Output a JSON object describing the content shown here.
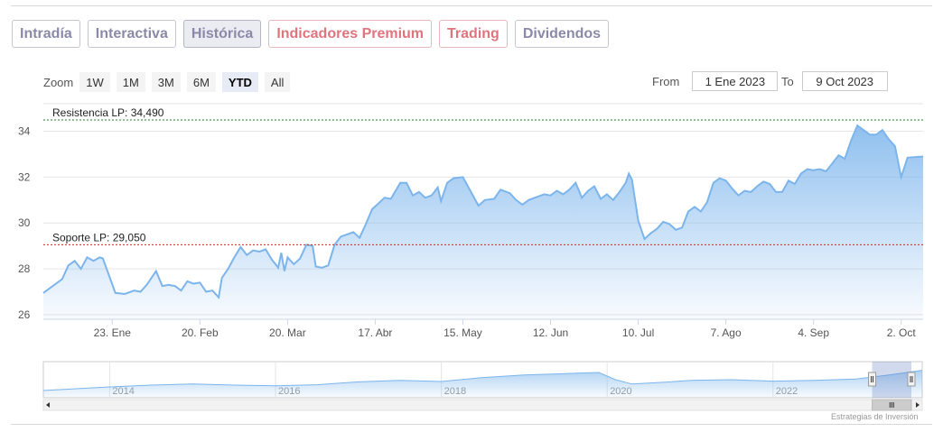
{
  "tabs": [
    {
      "label": "Intradía",
      "style": "normal"
    },
    {
      "label": "Interactiva",
      "style": "normal"
    },
    {
      "label": "Histórica",
      "style": "active"
    },
    {
      "label": "Indicadores Premium",
      "style": "red"
    },
    {
      "label": "Trading",
      "style": "red"
    },
    {
      "label": "Dividendos",
      "style": "normal"
    }
  ],
  "zoom": {
    "label": "Zoom",
    "buttons": [
      "1W",
      "1M",
      "3M",
      "6M",
      "YTD",
      "All"
    ],
    "selected": "YTD"
  },
  "range": {
    "from_label": "From",
    "from_value": "1 Ene 2023",
    "to_label": "To",
    "to_value": "9 Oct 2023"
  },
  "credits": "Estrategias de Inversión",
  "colors": {
    "line": "#7cb5ec",
    "area_top": "#7cb5ec",
    "resistance": "#2e7d32",
    "support": "#c62828"
  },
  "chart_data": {
    "type": "area",
    "title": "",
    "xlabel": "",
    "ylabel": "",
    "x_range": [
      "2023-01-01",
      "2023-10-09"
    ],
    "ylim": [
      25.8,
      35.2
    ],
    "y_ticks": [
      26,
      28,
      30,
      32,
      34
    ],
    "x_ticks": [
      {
        "date": "2023-01-23",
        "label": "23. Ene"
      },
      {
        "date": "2023-02-20",
        "label": "20. Feb"
      },
      {
        "date": "2023-03-20",
        "label": "20. Mar"
      },
      {
        "date": "2023-04-17",
        "label": "17. Abr"
      },
      {
        "date": "2023-05-15",
        "label": "15. May"
      },
      {
        "date": "2023-06-12",
        "label": "12. Jun"
      },
      {
        "date": "2023-07-10",
        "label": "10. Jul"
      },
      {
        "date": "2023-08-07",
        "label": "7. Ago"
      },
      {
        "date": "2023-09-04",
        "label": "4. Sep"
      },
      {
        "date": "2023-10-02",
        "label": "2. Oct"
      }
    ],
    "plot_lines": [
      {
        "label": "Resistencia LP: 34,490",
        "value": 34.49,
        "kind": "resistance"
      },
      {
        "label": "Soporte LP: 29,050",
        "value": 29.05,
        "kind": "support"
      }
    ],
    "series": [
      {
        "points": [
          [
            "2023-01-01",
            26.95
          ],
          [
            "2023-01-03",
            27.15
          ],
          [
            "2023-01-05",
            27.35
          ],
          [
            "2023-01-07",
            27.55
          ],
          [
            "2023-01-09",
            28.15
          ],
          [
            "2023-01-11",
            28.35
          ],
          [
            "2023-01-13",
            28.0
          ],
          [
            "2023-01-15",
            28.5
          ],
          [
            "2023-01-17",
            28.35
          ],
          [
            "2023-01-19",
            28.5
          ],
          [
            "2023-01-20",
            28.45
          ],
          [
            "2023-01-22",
            27.7
          ],
          [
            "2023-01-24",
            26.95
          ],
          [
            "2023-01-27",
            26.9
          ],
          [
            "2023-01-30",
            27.05
          ],
          [
            "2023-02-01",
            27.0
          ],
          [
            "2023-02-03",
            27.3
          ],
          [
            "2023-02-06",
            27.9
          ],
          [
            "2023-02-08",
            27.25
          ],
          [
            "2023-02-10",
            27.3
          ],
          [
            "2023-02-12",
            27.25
          ],
          [
            "2023-02-14",
            27.05
          ],
          [
            "2023-02-16",
            27.45
          ],
          [
            "2023-02-18",
            27.35
          ],
          [
            "2023-02-20",
            27.4
          ],
          [
            "2023-02-22",
            27.0
          ],
          [
            "2023-02-24",
            27.05
          ],
          [
            "2023-02-26",
            26.75
          ],
          [
            "2023-02-27",
            27.6
          ],
          [
            "2023-03-01",
            28.0
          ],
          [
            "2023-03-03",
            28.5
          ],
          [
            "2023-03-05",
            28.95
          ],
          [
            "2023-03-07",
            28.6
          ],
          [
            "2023-03-09",
            28.8
          ],
          [
            "2023-03-11",
            28.75
          ],
          [
            "2023-03-13",
            28.85
          ],
          [
            "2023-03-15",
            28.4
          ],
          [
            "2023-03-17",
            28.05
          ],
          [
            "2023-03-18",
            28.7
          ],
          [
            "2023-03-19",
            27.9
          ],
          [
            "2023-03-20",
            28.5
          ],
          [
            "2023-03-22",
            28.2
          ],
          [
            "2023-03-24",
            28.45
          ],
          [
            "2023-03-26",
            29.05
          ],
          [
            "2023-03-28",
            29.0
          ],
          [
            "2023-03-29",
            28.1
          ],
          [
            "2023-03-31",
            28.05
          ],
          [
            "2023-04-02",
            28.15
          ],
          [
            "2023-04-04",
            29.05
          ],
          [
            "2023-04-06",
            29.4
          ],
          [
            "2023-04-08",
            29.5
          ],
          [
            "2023-04-10",
            29.6
          ],
          [
            "2023-04-12",
            29.35
          ],
          [
            "2023-04-14",
            29.95
          ],
          [
            "2023-04-16",
            30.6
          ],
          [
            "2023-04-18",
            30.85
          ],
          [
            "2023-04-20",
            31.1
          ],
          [
            "2023-04-22",
            31.05
          ],
          [
            "2023-04-25",
            31.75
          ],
          [
            "2023-04-27",
            31.75
          ],
          [
            "2023-04-29",
            31.2
          ],
          [
            "2023-05-01",
            31.35
          ],
          [
            "2023-05-03",
            31.1
          ],
          [
            "2023-05-05",
            31.2
          ],
          [
            "2023-05-07",
            31.55
          ],
          [
            "2023-05-08",
            30.95
          ],
          [
            "2023-05-10",
            31.75
          ],
          [
            "2023-05-12",
            31.95
          ],
          [
            "2023-05-15",
            32.0
          ],
          [
            "2023-05-17",
            31.5
          ],
          [
            "2023-05-20",
            30.75
          ],
          [
            "2023-05-22",
            31.0
          ],
          [
            "2023-05-25",
            31.05
          ],
          [
            "2023-05-27",
            31.45
          ],
          [
            "2023-05-30",
            31.3
          ],
          [
            "2023-06-01",
            31.0
          ],
          [
            "2023-06-03",
            30.8
          ],
          [
            "2023-06-05",
            31.0
          ],
          [
            "2023-06-07",
            31.1
          ],
          [
            "2023-06-10",
            31.25
          ],
          [
            "2023-06-12",
            31.2
          ],
          [
            "2023-06-14",
            31.4
          ],
          [
            "2023-06-16",
            31.25
          ],
          [
            "2023-06-18",
            31.45
          ],
          [
            "2023-06-20",
            31.75
          ],
          [
            "2023-06-22",
            31.1
          ],
          [
            "2023-06-24",
            31.4
          ],
          [
            "2023-06-26",
            31.6
          ],
          [
            "2023-06-28",
            31.05
          ],
          [
            "2023-06-30",
            31.25
          ],
          [
            "2023-07-02",
            31.0
          ],
          [
            "2023-07-04",
            31.35
          ],
          [
            "2023-07-06",
            31.75
          ],
          [
            "2023-07-07",
            32.15
          ],
          [
            "2023-07-08",
            31.9
          ],
          [
            "2023-07-10",
            30.1
          ],
          [
            "2023-07-12",
            29.3
          ],
          [
            "2023-07-14",
            29.55
          ],
          [
            "2023-07-16",
            29.75
          ],
          [
            "2023-07-18",
            30.05
          ],
          [
            "2023-07-20",
            29.95
          ],
          [
            "2023-07-22",
            29.7
          ],
          [
            "2023-07-24",
            29.8
          ],
          [
            "2023-07-26",
            30.5
          ],
          [
            "2023-07-28",
            30.7
          ],
          [
            "2023-07-30",
            30.5
          ],
          [
            "2023-08-01",
            30.9
          ],
          [
            "2023-08-03",
            31.75
          ],
          [
            "2023-08-05",
            31.95
          ],
          [
            "2023-08-07",
            31.85
          ],
          [
            "2023-08-09",
            31.5
          ],
          [
            "2023-08-11",
            31.2
          ],
          [
            "2023-08-13",
            31.4
          ],
          [
            "2023-08-15",
            31.35
          ],
          [
            "2023-08-17",
            31.6
          ],
          [
            "2023-08-19",
            31.8
          ],
          [
            "2023-08-21",
            31.7
          ],
          [
            "2023-08-23",
            31.35
          ],
          [
            "2023-08-25",
            31.35
          ],
          [
            "2023-08-27",
            31.85
          ],
          [
            "2023-08-29",
            31.7
          ],
          [
            "2023-08-31",
            32.15
          ],
          [
            "2023-09-02",
            32.35
          ],
          [
            "2023-09-04",
            32.3
          ],
          [
            "2023-09-06",
            32.35
          ],
          [
            "2023-09-08",
            32.25
          ],
          [
            "2023-09-10",
            32.6
          ],
          [
            "2023-09-12",
            32.95
          ],
          [
            "2023-09-14",
            32.8
          ],
          [
            "2023-09-16",
            33.6
          ],
          [
            "2023-09-18",
            34.25
          ],
          [
            "2023-09-20",
            34.05
          ],
          [
            "2023-09-22",
            33.85
          ],
          [
            "2023-09-24",
            33.85
          ],
          [
            "2023-09-26",
            34.05
          ],
          [
            "2023-09-28",
            33.65
          ],
          [
            "2023-09-30",
            33.35
          ],
          [
            "2023-10-02",
            32.0
          ],
          [
            "2023-10-04",
            32.85
          ],
          [
            "2023-10-09",
            32.9
          ]
        ]
      }
    ],
    "navigator": {
      "x_ticks": [
        "2014",
        "2016",
        "2018",
        "2020",
        "2022"
      ],
      "years": [
        2013.2,
        2023.8
      ],
      "points": [
        [
          2013.2,
          26.0
        ],
        [
          2013.6,
          26.5
        ],
        [
          2014.0,
          27.0
        ],
        [
          2014.5,
          27.5
        ],
        [
          2015.0,
          27.8
        ],
        [
          2015.5,
          27.5
        ],
        [
          2016.0,
          27.3
        ],
        [
          2016.5,
          27.6
        ],
        [
          2017.0,
          28.4
        ],
        [
          2017.5,
          28.8
        ],
        [
          2018.0,
          28.5
        ],
        [
          2018.5,
          29.6
        ],
        [
          2019.0,
          30.3
        ],
        [
          2019.5,
          30.7
        ],
        [
          2019.9,
          31.0
        ],
        [
          2020.1,
          29.0
        ],
        [
          2020.3,
          27.8
        ],
        [
          2020.7,
          28.3
        ],
        [
          2021.0,
          28.8
        ],
        [
          2021.5,
          29.0
        ],
        [
          2022.0,
          28.6
        ],
        [
          2022.5,
          28.8
        ],
        [
          2023.0,
          29.2
        ],
        [
          2023.4,
          30.3
        ],
        [
          2023.8,
          31.6
        ]
      ]
    }
  }
}
